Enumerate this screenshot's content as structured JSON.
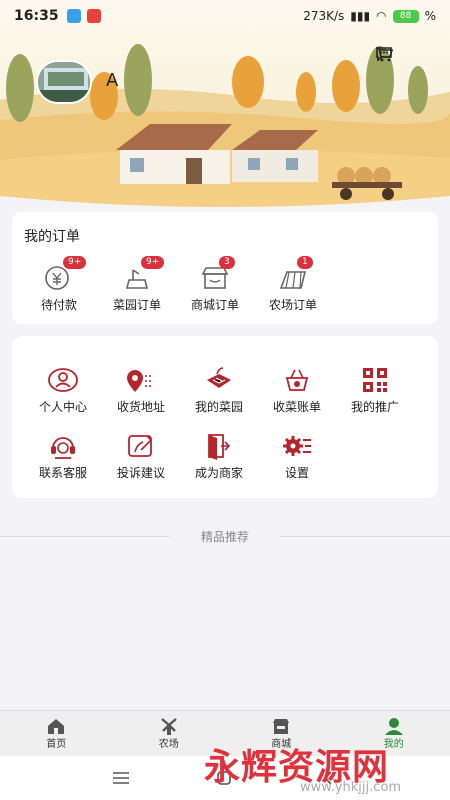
{
  "status_bar": {
    "time": "16:35",
    "speed": "273K/s",
    "battery": "88"
  },
  "profile": {
    "username": "A"
  },
  "orders": {
    "title": "我的订单",
    "items": [
      {
        "label": "待付款",
        "badge": "9+",
        "icon": "wallet-yen-icon"
      },
      {
        "label": "菜园订单",
        "badge": "9+",
        "icon": "garden-shovel-icon"
      },
      {
        "label": "商城订单",
        "badge": "3",
        "icon": "shop-icon"
      },
      {
        "label": "农场订单",
        "badge": "1",
        "icon": "farm-field-icon"
      }
    ]
  },
  "services": {
    "row1": [
      {
        "label": "个人中心",
        "icon": "person-icon"
      },
      {
        "label": "收货地址",
        "icon": "location-icon"
      },
      {
        "label": "我的菜园",
        "icon": "garden-bed-icon"
      },
      {
        "label": "收菜账单",
        "icon": "basket-icon"
      },
      {
        "label": "我的推广",
        "icon": "qrcode-icon"
      }
    ],
    "row2": [
      {
        "label": "联系客服",
        "icon": "headset-icon"
      },
      {
        "label": "投诉建议",
        "icon": "complaint-icon"
      },
      {
        "label": "成为商家",
        "icon": "merchant-door-icon"
      },
      {
        "label": "设置",
        "icon": "gear-icon"
      }
    ]
  },
  "recommend": {
    "title": "精品推荐"
  },
  "tabbar": [
    {
      "label": "首页",
      "icon": "home-icon"
    },
    {
      "label": "农场",
      "icon": "windmill-icon"
    },
    {
      "label": "商城",
      "icon": "store-icon"
    },
    {
      "label": "我的",
      "icon": "user-icon",
      "active": true
    }
  ],
  "watermark": {
    "text": "永辉资源网",
    "url": "www.yhkjjj.com"
  },
  "colors": {
    "accent_red": "#c8282f",
    "active_green": "#2a8a3a",
    "badge_red": "#d9323c"
  }
}
